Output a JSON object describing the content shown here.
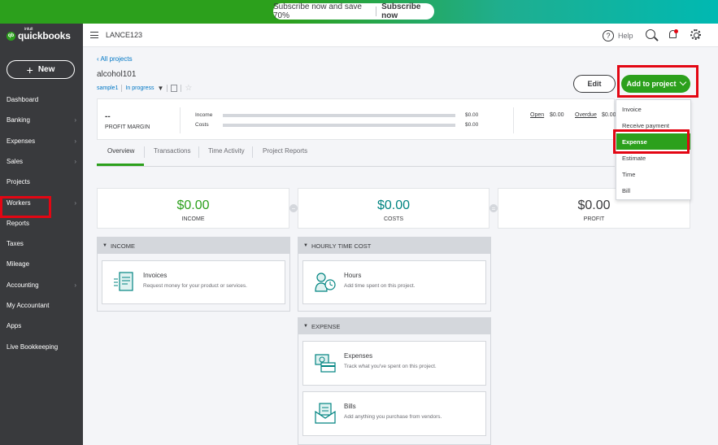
{
  "promo": {
    "text": "Subscribe now and save 70%",
    "cta": "Subscribe now"
  },
  "brand": {
    "intuit": "intuit",
    "name": "quickbooks",
    "mark": "qb"
  },
  "sidebar": {
    "new_label": "New",
    "items": [
      {
        "label": "Dashboard",
        "chevron": false
      },
      {
        "label": "Banking",
        "chevron": true
      },
      {
        "label": "Expenses",
        "chevron": true
      },
      {
        "label": "Sales",
        "chevron": true
      },
      {
        "label": "Projects",
        "chevron": false,
        "active": true
      },
      {
        "label": "Workers",
        "chevron": true
      },
      {
        "label": "Reports",
        "chevron": false
      },
      {
        "label": "Taxes",
        "chevron": false
      },
      {
        "label": "Mileage",
        "chevron": false
      },
      {
        "label": "Accounting",
        "chevron": true
      },
      {
        "label": "My Accountant",
        "chevron": false
      },
      {
        "label": "Apps",
        "chevron": false
      },
      {
        "label": "Live Bookkeeping",
        "chevron": false
      }
    ]
  },
  "topbar": {
    "company": "LANCE123",
    "help": "Help"
  },
  "project": {
    "back": "All projects",
    "title": "alcohol101",
    "customer": "sample1",
    "status": "In progress",
    "edit_label": "Edit",
    "add_label": "Add to project"
  },
  "summary": {
    "margin_value": "--",
    "margin_label": "PROFIT MARGIN",
    "income_label": "Income",
    "income_value": "$0.00",
    "costs_label": "Costs",
    "costs_value": "$0.00",
    "open_label": "Open",
    "open_value": "$0.00",
    "overdue_label": "Overdue",
    "overdue_value": "$0.00"
  },
  "tabs": [
    "Overview",
    "Transactions",
    "Time Activity",
    "Project Reports"
  ],
  "dropdown": [
    "Invoice",
    "Receive payment",
    "Expense",
    "Estimate",
    "Time",
    "Bill"
  ],
  "totals": {
    "income": {
      "value": "$0.00",
      "label": "INCOME"
    },
    "costs": {
      "value": "$0.00",
      "label": "COSTS"
    },
    "profit": {
      "value": "$0.00",
      "label": "PROFIT"
    },
    "op_minus": "−",
    "op_equals": "="
  },
  "sections": {
    "income": {
      "title": "INCOME",
      "items": [
        {
          "title": "Invoices",
          "desc": "Request money for your product or services."
        }
      ]
    },
    "hourly": {
      "title": "HOURLY TIME COST",
      "items": [
        {
          "title": "Hours",
          "desc": "Add time spent on this project."
        }
      ]
    },
    "expense": {
      "title": "EXPENSE",
      "items": [
        {
          "title": "Expenses",
          "desc": "Track what you've spent on this project."
        },
        {
          "title": "Bills",
          "desc": "Add anything you purchase from vendors."
        }
      ]
    }
  },
  "colors": {
    "brand_green": "#2ca01c",
    "annotation_red": "#e30613",
    "sidebar_bg": "#393a3d",
    "link_blue": "#0077c5"
  }
}
